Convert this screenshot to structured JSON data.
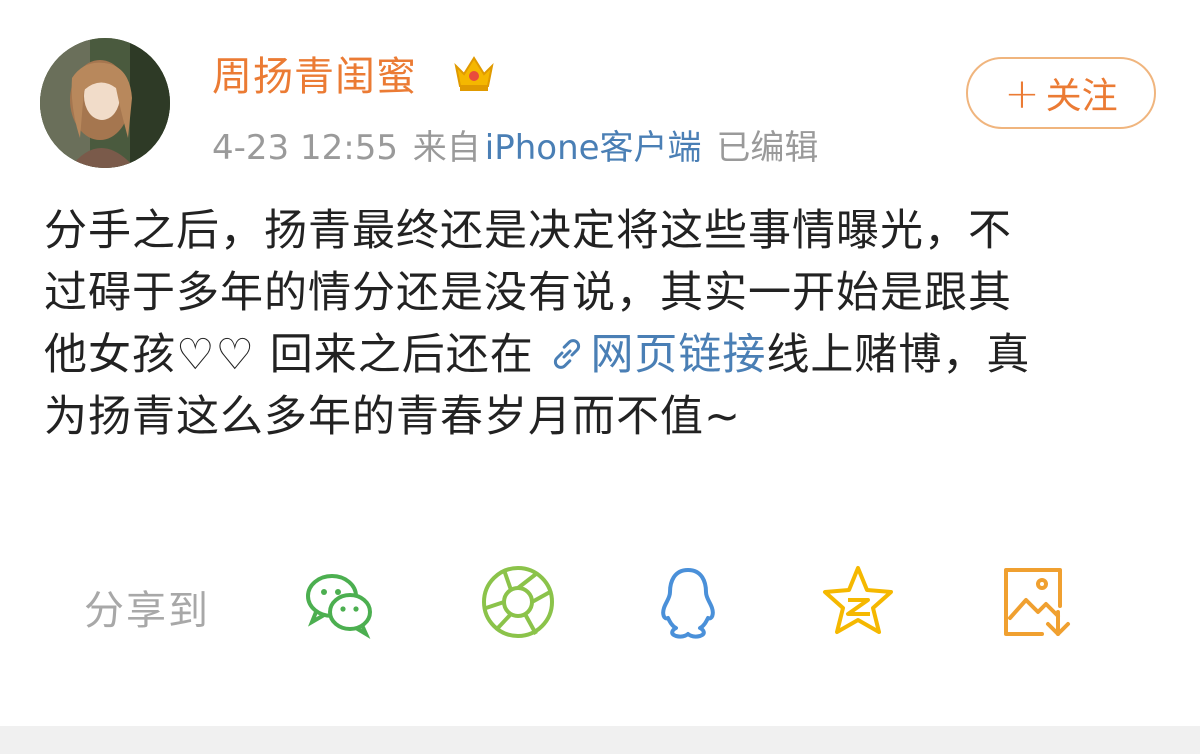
{
  "post": {
    "author": "周扬青闺蜜",
    "badge_icon": "crown-icon",
    "time": "4-23 12:55",
    "source_prefix": "来自",
    "source": "iPhone客户端",
    "edited": "已编辑",
    "follow_label": "关注",
    "follow_plus": "+",
    "lines": [
      {
        "text": "分手之后，扬青最终还是决定将这些事情曝光，不"
      },
      {
        "text": "过碍于多年的情分还是没有说，其实一开始是跟其"
      },
      {
        "pre": "他女孩♡♡ 回来之后还在 ",
        "link": "网页链接",
        "post": "线上赌博，真"
      },
      {
        "text": "为扬青这么多年的青春岁月而不值~"
      }
    ]
  },
  "share": {
    "label": "分享到",
    "targets": [
      "wechat-icon",
      "moments-icon",
      "qq-icon",
      "qzone-icon",
      "save-image-icon"
    ]
  },
  "colors": {
    "accent": "#eb7b34",
    "link": "#4a7fb5",
    "meta": "#9a9a9a",
    "wechat": "#4caf50",
    "moments": "#8bc34a",
    "qq": "#4a90d9",
    "qzone": "#f5b800",
    "save": "#f0a030"
  }
}
